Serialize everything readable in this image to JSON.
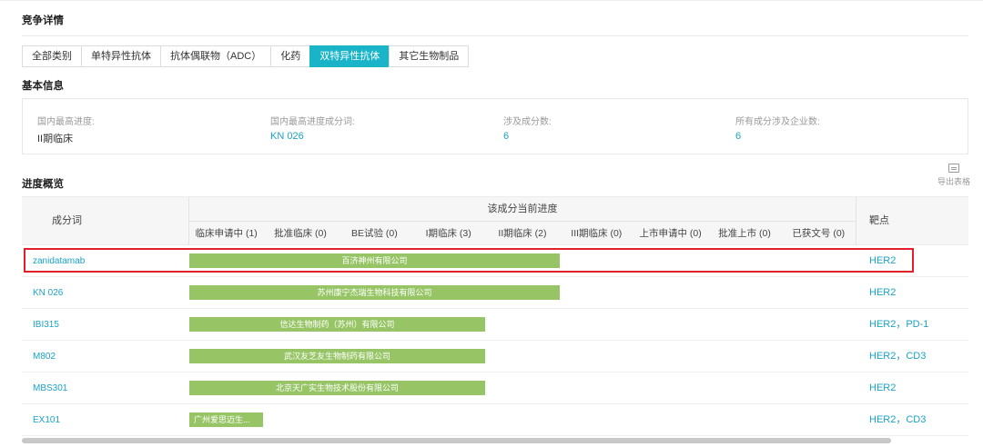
{
  "section_competition": "竞争详情",
  "tabs": [
    {
      "label": "全部类别",
      "active": false
    },
    {
      "label": "单特异性抗体",
      "active": false
    },
    {
      "label": "抗体偶联物（ADC）",
      "active": false
    },
    {
      "label": "化药",
      "active": false
    },
    {
      "label": "双特异性抗体",
      "active": true
    },
    {
      "label": "其它生物制品",
      "active": false
    }
  ],
  "section_basic": "基本信息",
  "basic_info": {
    "highest_stage_label": "国内最高进度:",
    "highest_stage_value": "II期临床",
    "highest_component_label": "国内最高进度成分词:",
    "highest_component_value": "KN 026",
    "component_count_label": "涉及成分数:",
    "component_count_value": "6",
    "company_count_label": "所有成分涉及企业数:",
    "company_count_value": "6"
  },
  "section_progress": "进度概览",
  "export_label": "导出表格",
  "table": {
    "col_name": "成分词",
    "col_progress": "该成分当前进度",
    "col_target": "靶点",
    "stages": [
      "临床申请中 (1)",
      "批准临床 (0)",
      "BE试验 (0)",
      "I期临床 (3)",
      "II期临床 (2)",
      "III期临床 (0)",
      "上市申请中 (0)",
      "批准上市 (0)",
      "已获文号 (0)"
    ],
    "rows": [
      {
        "name": "zanidatamab",
        "company": "百济神州有限公司",
        "stage_reached": 5,
        "targets": "HER2"
      },
      {
        "name": "KN 026",
        "company": "苏州康宁杰瑞生物科技有限公司",
        "stage_reached": 5,
        "targets": "HER2"
      },
      {
        "name": "IBI315",
        "company": "信达生物制药（苏州）有限公司",
        "stage_reached": 4,
        "targets": "HER2，PD-1"
      },
      {
        "name": "M802",
        "company": "武汉友芝友生物制药有限公司",
        "stage_reached": 4,
        "targets": "HER2，CD3"
      },
      {
        "name": "MBS301",
        "company": "北京天广实生物技术股份有限公司",
        "stage_reached": 4,
        "targets": "HER2"
      },
      {
        "name": "EX101",
        "company": "广州爱思迈生...",
        "stage_reached": 1,
        "targets": "HER2，CD3"
      }
    ]
  },
  "colors": {
    "accent": "#19b4c8",
    "link": "#1aa3c6",
    "bar": "#97c566",
    "highlight": "#e0202a"
  }
}
